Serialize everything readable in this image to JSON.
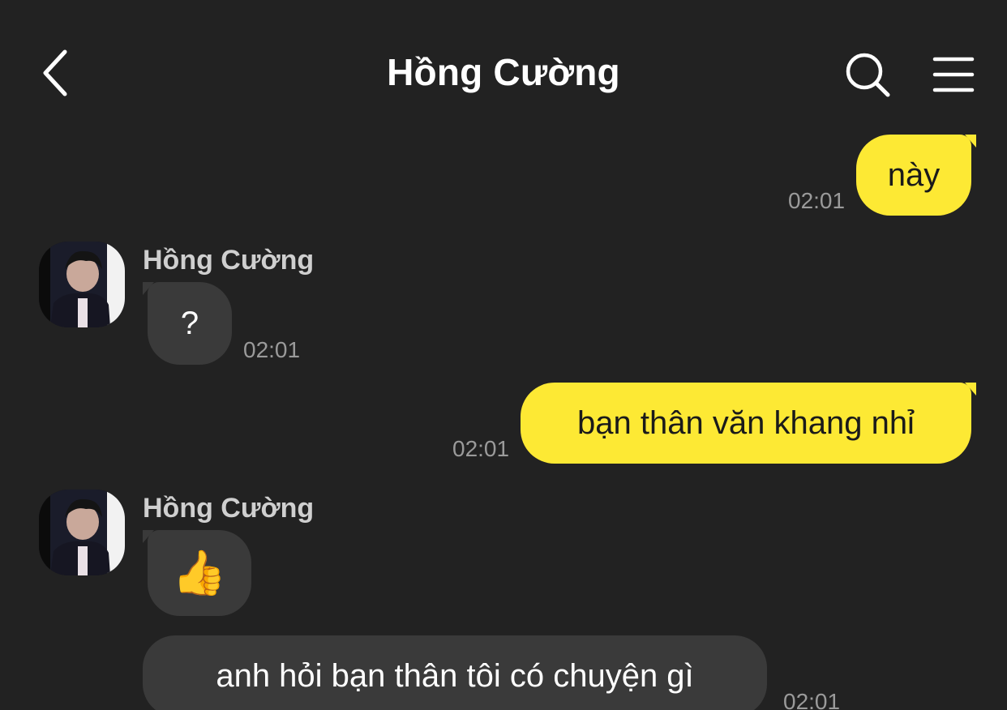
{
  "header": {
    "title": "Hồng Cường"
  },
  "messages": [
    {
      "direction": "outgoing",
      "text": "này",
      "time": "02:01"
    },
    {
      "direction": "incoming",
      "sender": "Hồng Cường",
      "text": "?",
      "time": "02:01"
    },
    {
      "direction": "outgoing",
      "text": "bạn thân văn khang nhỉ",
      "time": "02:01"
    },
    {
      "direction": "incoming",
      "sender": "Hồng Cường",
      "text": "👍",
      "time": ""
    },
    {
      "direction": "incoming",
      "text": "anh hỏi bạn thân tôi có chuyện gì",
      "time": "02:01"
    }
  ],
  "colors": {
    "background": "#222222",
    "outgoing_bubble": "#fde934",
    "incoming_bubble": "#3a3a3a",
    "timestamp": "#9a9a9a"
  },
  "icons": {
    "back": "chevron-left-icon",
    "search": "search-icon",
    "menu": "hamburger-menu-icon"
  }
}
